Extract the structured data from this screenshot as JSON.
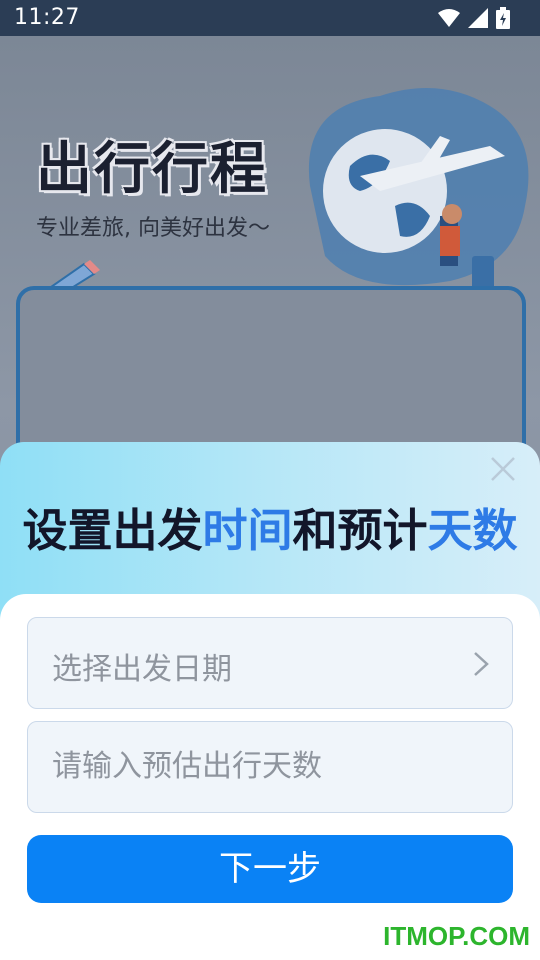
{
  "status": {
    "time": "11:27"
  },
  "background": {
    "title": "出行行程",
    "subtitle": "专业差旅, 向美好出发～"
  },
  "sheet": {
    "title_parts": [
      "设置出发",
      "时间",
      "和预计",
      "天数"
    ],
    "date_field": {
      "placeholder": "选择出发日期"
    },
    "days_field": {
      "placeholder": "请输入预估出行天数"
    },
    "next_label": "下一步"
  },
  "watermark": "ITMOP.COM",
  "colors": {
    "accent": "#0a82f5",
    "highlight": "#2e7be6",
    "watermark": "#2db52d"
  },
  "icons": [
    "wifi-icon",
    "signal-icon",
    "battery-icon",
    "close-icon",
    "chevron-right-icon"
  ]
}
